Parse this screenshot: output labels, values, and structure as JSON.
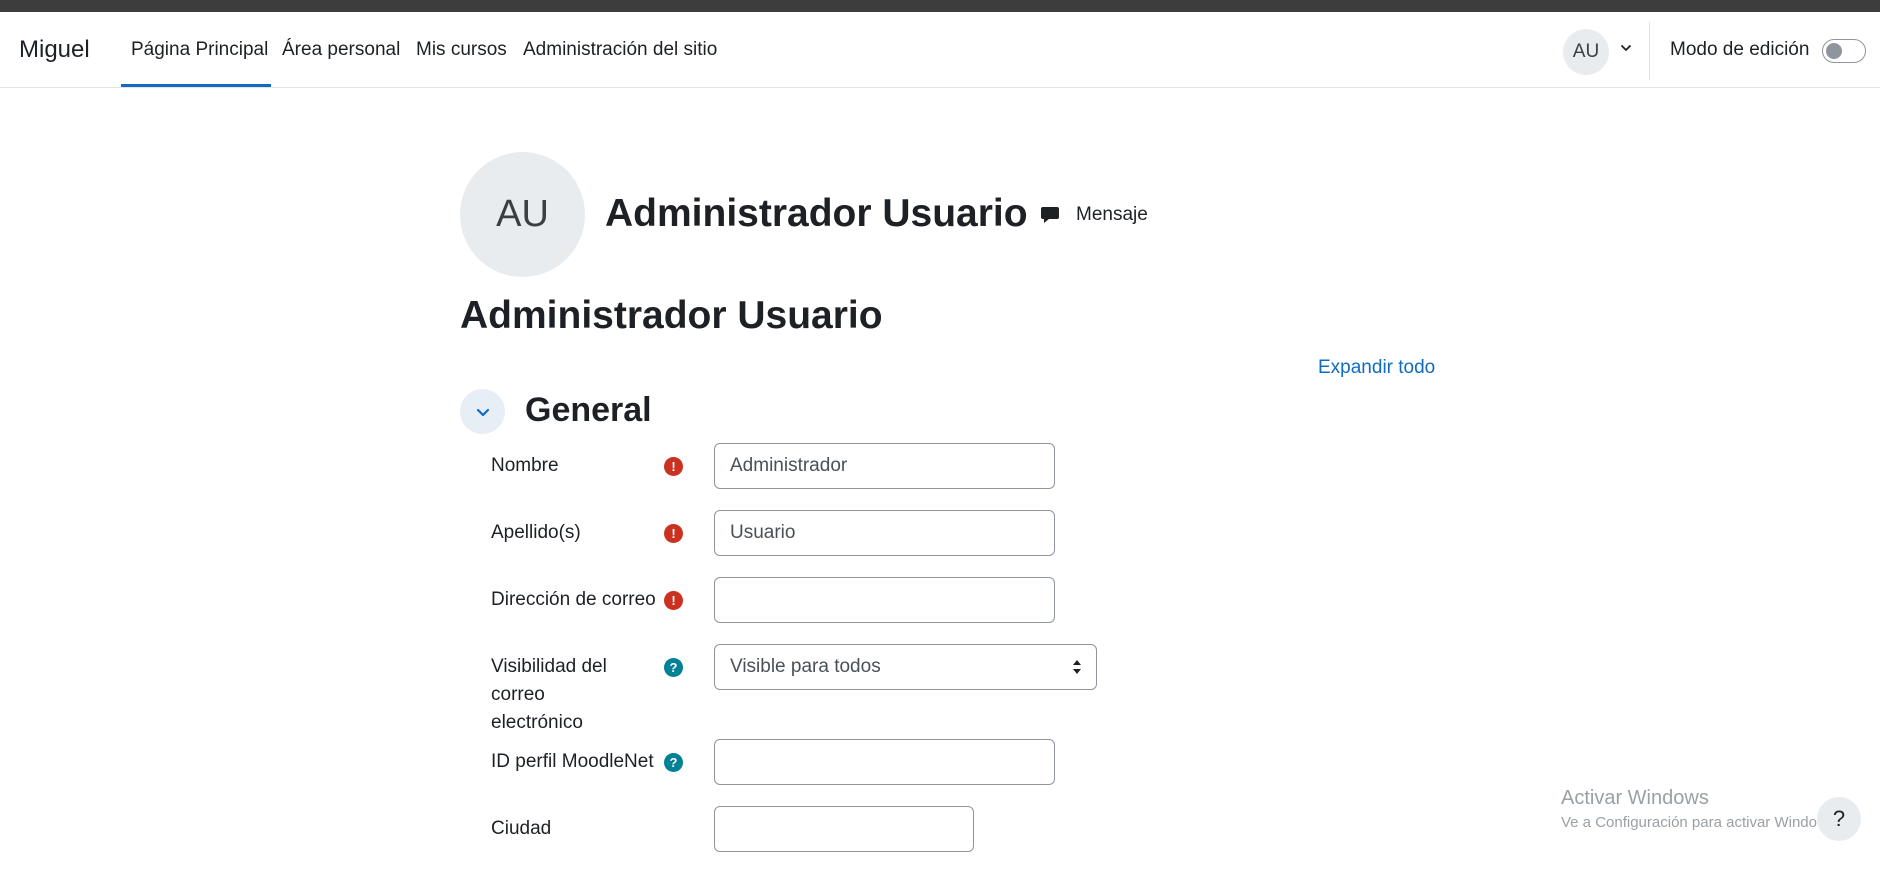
{
  "navbar": {
    "brand": "Miguel",
    "links": [
      {
        "label": "Página Principal",
        "active": true
      },
      {
        "label": "Área personal"
      },
      {
        "label": "Mis cursos"
      },
      {
        "label": "Administración del sitio"
      }
    ],
    "user_initials": "AU",
    "edit_mode_label": "Modo de edición",
    "edit_mode_on": false
  },
  "profile": {
    "initials": "AU",
    "name": "Administrador Usuario",
    "message_label": "Mensaje"
  },
  "page": {
    "title": "Administrador Usuario",
    "expand_all": "Expandir todo"
  },
  "section": {
    "title": "General",
    "fields": [
      {
        "label": "Nombre",
        "icon": "required-icon",
        "value": ""
      },
      {
        "label": "Apellido(s)",
        "icon": "required-icon",
        "value": ""
      },
      {
        "label": "Dirección de correo",
        "icon": "required-icon",
        "value": ""
      },
      {
        "label": "Visibilidad del correo electrónico",
        "icon": "help-icon",
        "value": "Visible para todos"
      },
      {
        "label": "ID perfil MoodleNet",
        "icon": "help-icon",
        "value": ""
      },
      {
        "label": "Ciudad",
        "icon": "",
        "value": ""
      }
    ],
    "name_value": "Administrador",
    "surname_value": "Usuario"
  },
  "overlay": {
    "watermark_line1": "Activar Windows",
    "watermark_line2": "Ve a Configuración para activar Windows.",
    "help_button": "?"
  },
  "colors": {
    "accent": "#0f6cbf",
    "required": "#ca3120",
    "help": "#008196",
    "topstrip": "#3d3d3d"
  }
}
